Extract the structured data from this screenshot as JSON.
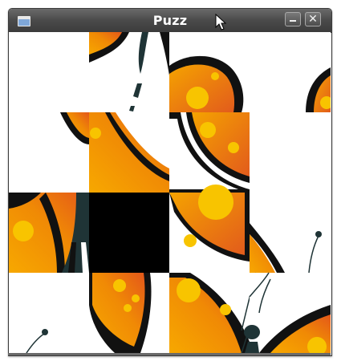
{
  "window": {
    "title": "Puzz",
    "minimize_glyph": "—",
    "close_glyph": "✕"
  },
  "icons": {
    "app": "window-app-icon",
    "minimize": "minimize-icon",
    "close": "close-icon",
    "cursor": "pointer-cursor-icon"
  },
  "colors": {
    "titlebar": "#4a4a4a",
    "wing_orange": "#f5a000",
    "wing_red": "#e4571a",
    "spot_yellow": "#f8c400",
    "outline": "#111111",
    "body": "#1f3436",
    "empty_tile": "#000000"
  },
  "puzzle": {
    "grid": "4x4",
    "empty_tile": {
      "row": 3,
      "col": 2
    }
  }
}
